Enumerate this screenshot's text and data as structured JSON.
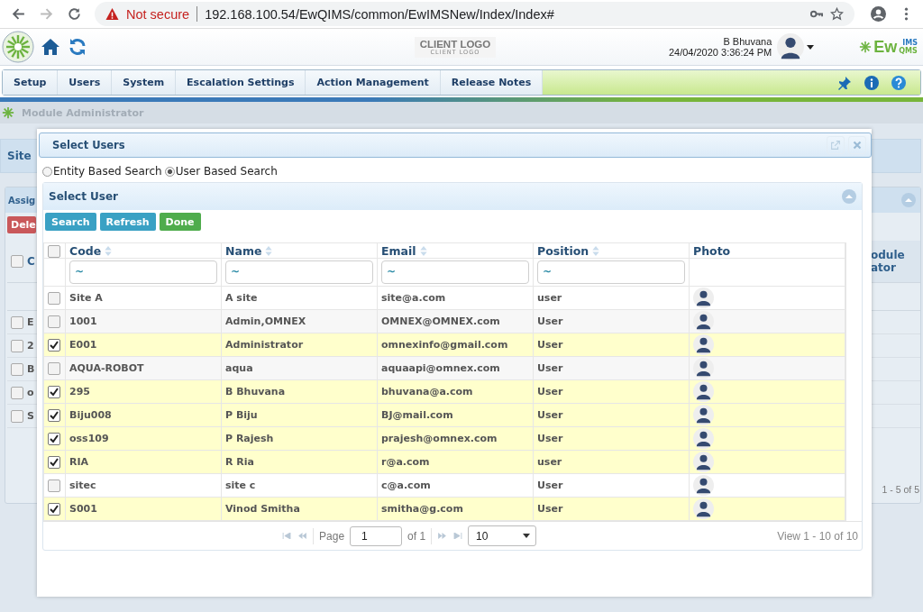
{
  "browser": {
    "security": "Not secure",
    "url": "192.168.100.54/EwQIMS/common/EwIMSNew/Index/Index#"
  },
  "header": {
    "client_logo": "CLIENT LOGO",
    "client_logo_sub": "CLIENT LOGO",
    "user_name": "B Bhuvana",
    "datetime": "24/04/2020 3:36:24 PM",
    "brand": "Ew",
    "brand_top": "IMS",
    "brand_bottom": "QMS"
  },
  "nav": [
    {
      "label": "Setup"
    },
    {
      "label": "Users"
    },
    {
      "label": "System"
    },
    {
      "label": "Escalation Settings"
    },
    {
      "label": "Action Management"
    },
    {
      "label": "Release Notes"
    }
  ],
  "breadcrumb": "Module Administrator",
  "background": {
    "site_tab": "Site",
    "panel_title": "Assig",
    "delete_button": "Dele",
    "column_head": "C",
    "header_checked": false,
    "column_right": "odule ator",
    "rows": [
      {
        "label": "E",
        "checked": false
      },
      {
        "label": "2",
        "checked": false
      },
      {
        "label": "B",
        "checked": false
      },
      {
        "label": "o",
        "checked": false
      },
      {
        "label": "S",
        "checked": false
      }
    ],
    "pager": "1 - 5 of 5"
  },
  "dialog": {
    "title": "Select Users",
    "search_modes": [
      {
        "label": "Entity Based Search",
        "selected": false
      },
      {
        "label": "User Based Search",
        "selected": true
      }
    ],
    "panel_title": "Select User",
    "buttons": [
      {
        "label": "Search",
        "kind": "primary"
      },
      {
        "label": "Refresh",
        "kind": "primary"
      },
      {
        "label": "Done",
        "kind": "success"
      }
    ],
    "select_all_checked": false,
    "columns": [
      {
        "label": "Code",
        "sortable": true
      },
      {
        "label": "Name",
        "sortable": true
      },
      {
        "label": "Email",
        "sortable": true
      },
      {
        "label": "Position",
        "sortable": true
      },
      {
        "label": "Photo",
        "sortable": false
      }
    ],
    "filters": [
      "~",
      "~",
      "~",
      "~"
    ],
    "rows": [
      {
        "code": "Site A",
        "name": "A site",
        "email": "site@a.com",
        "position": "user",
        "checked": false
      },
      {
        "code": "1001",
        "name": "Admin,OMNEX",
        "email": "OMNEX@OMNEX.com",
        "position": "User",
        "checked": false
      },
      {
        "code": "E001",
        "name": "Administrator",
        "email": "omnexinfo@gmail.com",
        "position": "User",
        "checked": true
      },
      {
        "code": "AQUA-ROBOT",
        "name": "aqua",
        "email": "aquaapi@omnex.com",
        "position": "User",
        "checked": false
      },
      {
        "code": "295",
        "name": "B Bhuvana",
        "email": "bhuvana@a.com",
        "position": "User",
        "checked": true
      },
      {
        "code": "Biju008",
        "name": "P Biju",
        "email": "BJ@mail.com",
        "position": "User",
        "checked": true
      },
      {
        "code": "oss109",
        "name": "P Rajesh",
        "email": "prajesh@omnex.com",
        "position": "User",
        "checked": true
      },
      {
        "code": "RIA",
        "name": "R Ria",
        "email": "r@a.com",
        "position": "user",
        "checked": true
      },
      {
        "code": "sitec",
        "name": "site c",
        "email": "c@a.com",
        "position": "User",
        "checked": false
      },
      {
        "code": "S001",
        "name": "Vinod Smitha",
        "email": "smitha@g.com",
        "position": "User",
        "checked": true
      }
    ],
    "pager": {
      "page_label": "Page",
      "page": "1",
      "of": "of 1",
      "page_size": "10",
      "summary": "View 1 - 10 of 10"
    }
  }
}
